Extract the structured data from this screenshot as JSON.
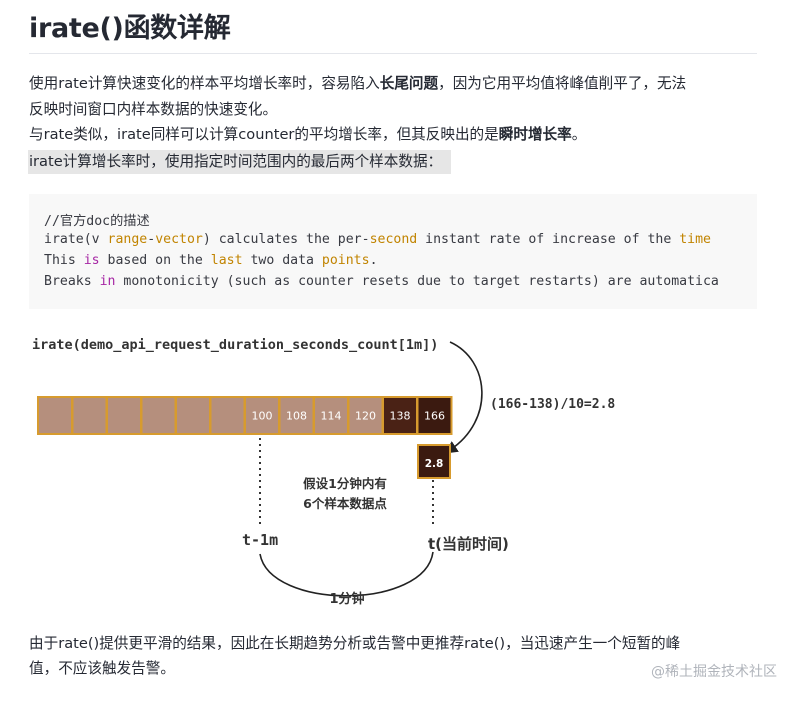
{
  "title": "irate()函数详解",
  "intro": {
    "line1_pre": "使用rate计算快速变化的样本平均增长率时，容易陷入",
    "line1_bold": "长尾问题",
    "line1_post": "，因为它用平均值将峰值削平了，无法",
    "line2": "反映时间窗口内样本数据的快速变化。",
    "line3_pre": "与rate类似，irate同样可以计算counter的平均增长率，但其反映出的是",
    "line3_bold": "瞬时增长率",
    "line3_post": "。",
    "line4": "irate计算增长率时，使用指定时间范围内的最后两个样本数据："
  },
  "code": {
    "comment": "//官方doc的描述",
    "line2": {
      "a": "irate(v ",
      "b": "range",
      "c": "-",
      "d": "vector",
      "e": ") calculates the per-",
      "f": "second",
      "g": " instant rate of increase of the ",
      "h": "time"
    },
    "line3": {
      "a": "This ",
      "b": "is",
      "c": " based on the ",
      "d": "last",
      "e": " two data ",
      "f": "points",
      "g": "."
    },
    "line4": {
      "a": "Breaks ",
      "b": "in",
      "c": " monotonicity (such as counter resets due to target restarts) are automatica"
    }
  },
  "diagram": {
    "query": "irate(demo_api_request_duration_seconds_count[1m])",
    "formula": "(166-138)/10=2.8",
    "samples": [
      "",
      "",
      "",
      "",
      "",
      "",
      "100",
      "108",
      "114",
      "120",
      "138",
      "166"
    ],
    "result": "2.8",
    "note_line1": "假设1分钟内有",
    "note_line2": "6个样本数据点",
    "t_start": "t-1m",
    "t_now": "t(当前时间)",
    "span_label": "1分钟",
    "colors": {
      "cell_fill": "#b58f7d",
      "cell_border": "#d79b2e",
      "cell_dark": "#4a2215",
      "cell_darker": "#3b1a10"
    }
  },
  "outro": {
    "line1": "由于rate()提供更平滑的结果，因此在长期趋势分析或告警中更推荐rate()，当迅速产生一个短暂的峰",
    "line2": "值，不应该触发告警。"
  },
  "watermark": "@稀土掘金技术社区"
}
